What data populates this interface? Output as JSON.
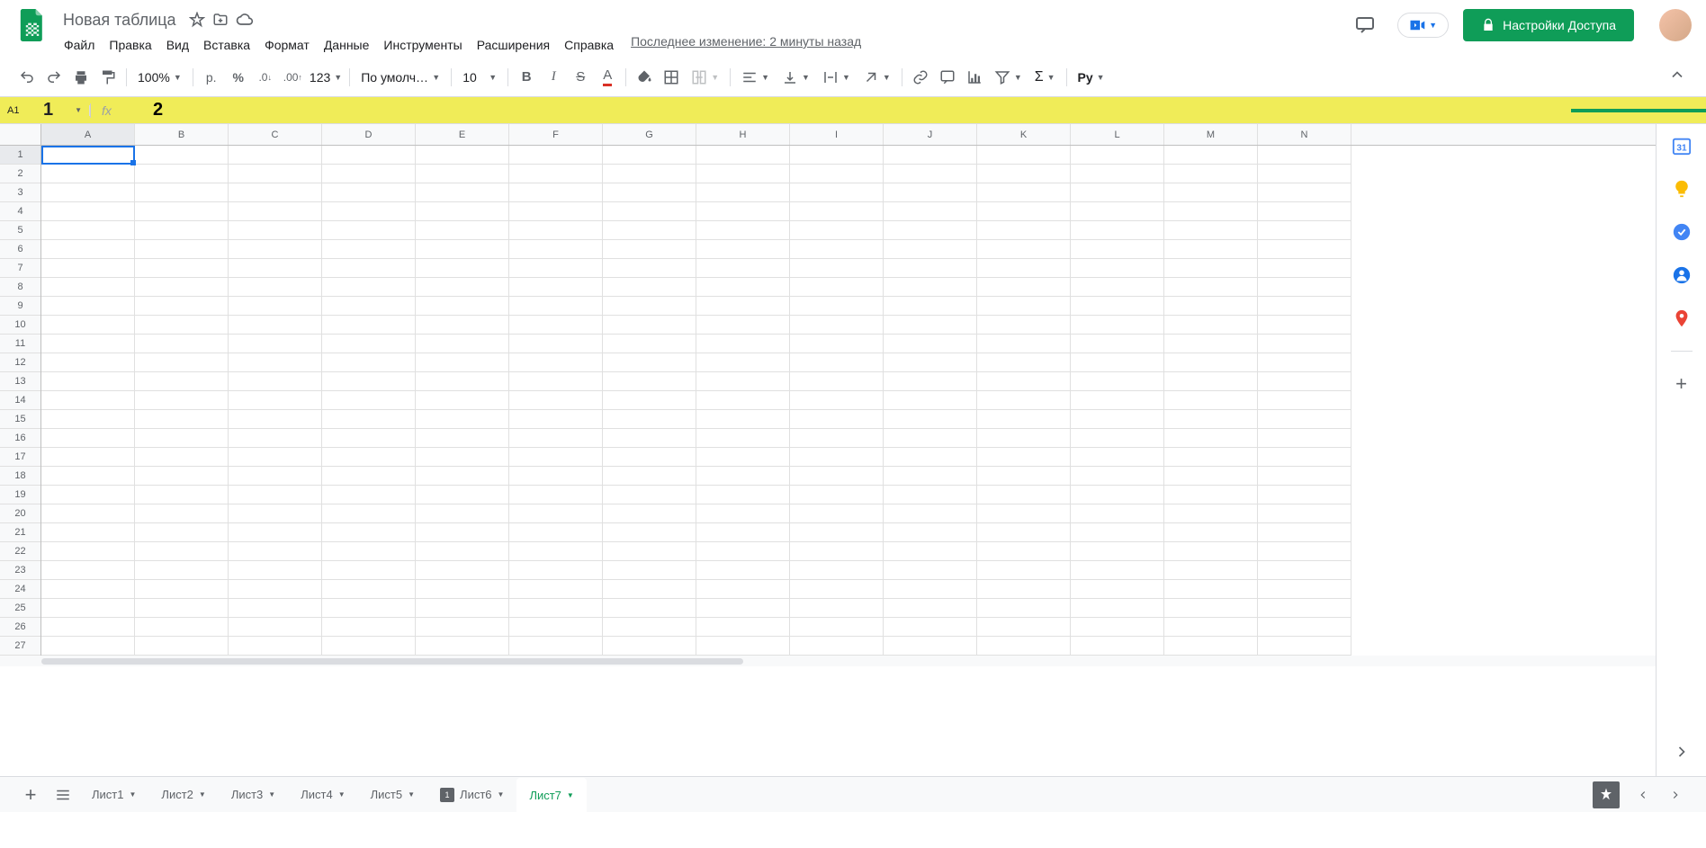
{
  "header": {
    "title": "Новая таблица",
    "last_edit": "Последнее изменение: 2 минуты назад",
    "share_label": "Настройки Доступа"
  },
  "menu": {
    "file": "Файл",
    "edit": "Правка",
    "view": "Вид",
    "insert": "Вставка",
    "format": "Формат",
    "data": "Данные",
    "tools": "Инструменты",
    "extensions": "Расширения",
    "help": "Справка"
  },
  "toolbar": {
    "zoom": "100%",
    "currency": "р.",
    "percent": "%",
    "dec_dec": ".0",
    "dec_inc": ".00",
    "format123": "123",
    "font": "По умолча...",
    "size": "10",
    "py": "Ру"
  },
  "formula": {
    "cell_ref": "A1",
    "annot1": "1",
    "annot2": "2",
    "value": ""
  },
  "columns": [
    "A",
    "B",
    "C",
    "D",
    "E",
    "F",
    "G",
    "H",
    "I",
    "J",
    "K",
    "L",
    "M",
    "N"
  ],
  "rows": [
    "1",
    "2",
    "3",
    "4",
    "5",
    "6",
    "7",
    "8",
    "9",
    "10",
    "11",
    "12",
    "13",
    "14",
    "15",
    "16",
    "17",
    "18",
    "19",
    "20",
    "21",
    "22",
    "23",
    "24",
    "25",
    "26",
    "27"
  ],
  "sheets": {
    "s1": "Лист1",
    "s2": "Лист2",
    "s3": "Лист3",
    "s4": "Лист4",
    "s5": "Лист5",
    "s6": "Лист6",
    "s7": "Лист7"
  }
}
